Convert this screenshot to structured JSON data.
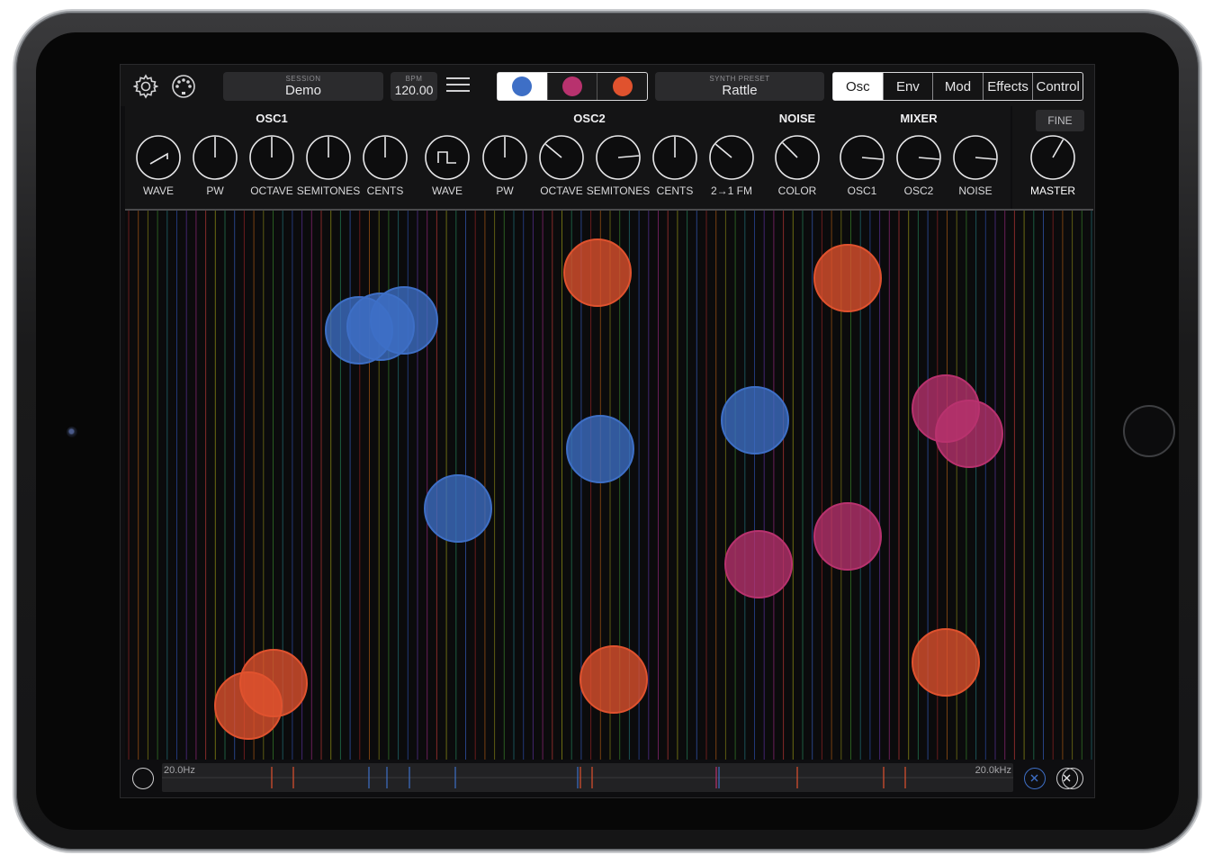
{
  "header": {
    "session_caption": "SESSION",
    "session_name": "Demo",
    "bpm_caption": "BPM",
    "bpm_value": "120.00",
    "preset_caption": "SYNTH PRESET",
    "preset_name": "Rattle"
  },
  "synth_slots": [
    {
      "color": "#3e6fc6",
      "active": true
    },
    {
      "color": "#b8326e",
      "active": false
    },
    {
      "color": "#e0522e",
      "active": false
    }
  ],
  "tabs": [
    "Osc",
    "Env",
    "Mod",
    "Effects",
    "Control"
  ],
  "active_tab": "Osc",
  "sections": {
    "osc1": "OSC1",
    "osc2": "OSC2",
    "noise": "NOISE",
    "mixer": "MIXER"
  },
  "knob_labels": {
    "osc1_wave": "WAVE",
    "osc1_pw": "PW",
    "osc1_octave": "OCTAVE",
    "osc1_semitones": "SEMITONES",
    "osc1_cents": "CENTS",
    "osc2_wave": "WAVE",
    "osc2_pw": "PW",
    "osc2_octave": "OCTAVE",
    "osc2_semitones": "SEMITONES",
    "osc2_cents": "CENTS",
    "osc2_fm": "2→1 FM",
    "noise_color": "COLOR",
    "mixer_osc1": "OSC1",
    "mixer_osc2": "OSC2",
    "mixer_noise": "NOISE",
    "master": "MASTER"
  },
  "fine_label": "FINE",
  "freq_min": "20.0Hz",
  "freq_max": "20.0kHz",
  "colors": {
    "blue": "#3e6fc6",
    "magenta": "#b8326e",
    "orange": "#e0522e"
  }
}
